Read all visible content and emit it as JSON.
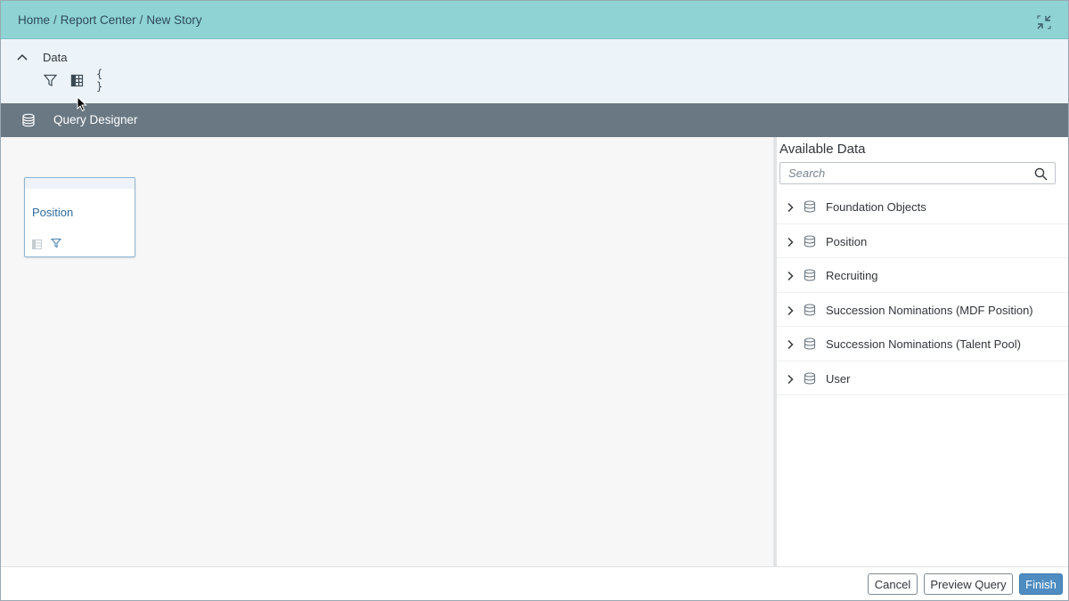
{
  "breadcrumb": {
    "items": [
      "Home",
      "Report Center",
      "New Story"
    ],
    "separator": "/"
  },
  "header": {
    "collapse_icon": "exit-fullscreen-icon"
  },
  "data_section": {
    "label": "Data",
    "toggle_icon": "chevron-up-icon",
    "tools": [
      {
        "name": "filter-icon",
        "glyph": "⛉"
      },
      {
        "name": "table-icon",
        "glyph": ""
      },
      {
        "name": "braces-icon",
        "glyph": "{ }"
      }
    ]
  },
  "query_designer": {
    "title": "Query Designer",
    "icon": "database-icon"
  },
  "canvas": {
    "node": {
      "label": "Position",
      "icons": [
        "table-icon",
        "filter-icon"
      ]
    }
  },
  "available_data": {
    "title": "Available Data",
    "search_placeholder": "Search",
    "search_value": "",
    "items": [
      {
        "label": "Foundation Objects"
      },
      {
        "label": "Position"
      },
      {
        "label": "Recruiting"
      },
      {
        "label": "Succession Nominations (MDF Position)"
      },
      {
        "label": "Succession Nominations (Talent Pool)"
      },
      {
        "label": "User"
      }
    ]
  },
  "footer": {
    "cancel_label": "Cancel",
    "preview_label": "Preview Query",
    "finish_label": "Finish"
  },
  "colors": {
    "topbar": "#8fd3d4",
    "databar": "#edf4f9",
    "qd_header": "#6a7883",
    "canvas": "#f7f7f7",
    "primary_button": "#4e8cc1"
  }
}
